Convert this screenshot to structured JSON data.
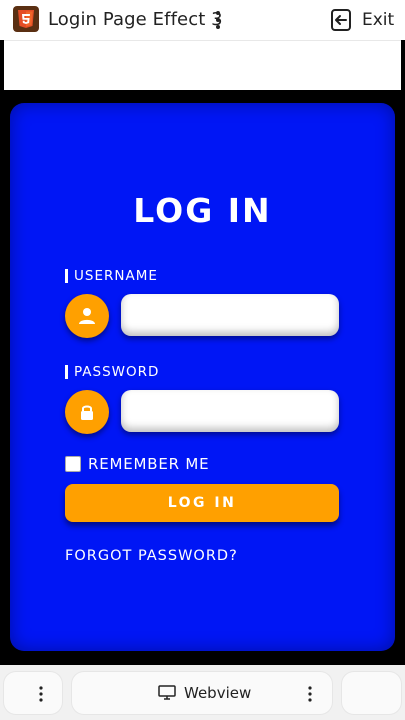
{
  "header": {
    "title": "Login Page Effect 3",
    "exit_label": "Exit"
  },
  "login": {
    "heading": "LOG IN",
    "username_label": "USERNAME",
    "username_value": "",
    "password_label": "PASSWORD",
    "password_value": "",
    "remember_label": "REMEMBER ME",
    "button_label": "LOG IN",
    "forgot_label": "FORGOT PASSWORD?"
  },
  "bottom_bar": {
    "webview_label": "Webview"
  },
  "icons": {
    "app": "html5-icon",
    "menu": "more-vert-icon",
    "exit": "exit-icon",
    "user": "user-icon",
    "lock": "lock-icon",
    "webview": "monitor-icon"
  },
  "colors": {
    "card_background": "#0016f5",
    "accent": "#ffa000",
    "text_on_card": "#ffffff"
  }
}
